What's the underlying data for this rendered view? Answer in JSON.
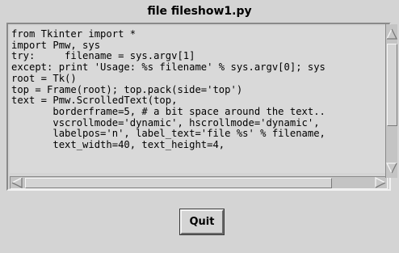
{
  "window": {
    "title_label": "file fileshow1.py"
  },
  "editor": {
    "lines": [
      "from Tkinter import *",
      "import Pmw, sys",
      "try:     filename = sys.argv[1]",
      "except: print 'Usage: %s filename' % sys.argv[0]; sys",
      "root = Tk()",
      "top = Frame(root); top.pack(side='top')",
      "text = Pmw.ScrolledText(top,",
      "       borderframe=5, # a bit space around the text..",
      "       vscrollmode='dynamic', hscrollmode='dynamic',",
      "       labelpos='n', label_text='file %s' % filename,",
      "       text_width=40, text_height=4,"
    ]
  },
  "scrollbars": {
    "vertical_icons": [
      "arrow-up-icon",
      "arrow-down-icon"
    ],
    "horizontal_icons": [
      "arrow-left-icon",
      "arrow-right-icon"
    ]
  },
  "buttons": {
    "quit_label": "Quit"
  },
  "colors": {
    "background": "#d4d4d4",
    "text_area": "#d9d9d9",
    "text": "#000000"
  }
}
